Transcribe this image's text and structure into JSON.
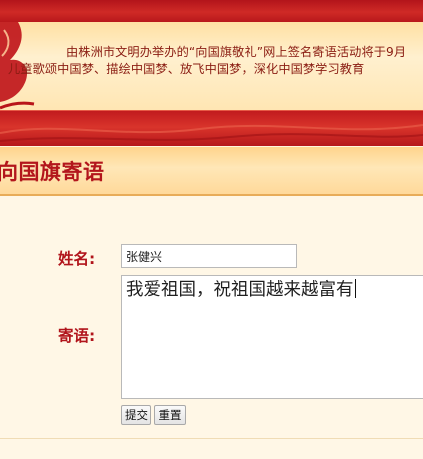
{
  "banner": {
    "line1": "由株洲市文明办举办的“向国旗敬礼”网上签名寄语活动将于9月",
    "line2": "儿童歌颂中国梦、描绘中国梦、放飞中国梦，深化中国梦学习教育"
  },
  "section": {
    "title": "向国旗寄语"
  },
  "form": {
    "name_label": "姓名:",
    "name_value": "张健兴",
    "message_label": "寄语:",
    "message_value": "我爱祖国，祝祖国越来越富有",
    "submit_label": "提交",
    "reset_label": "重置"
  },
  "colors": {
    "brand_red": "#b3161c",
    "banner_text": "#8a1c12",
    "panel_bg": "#fff7e6"
  }
}
